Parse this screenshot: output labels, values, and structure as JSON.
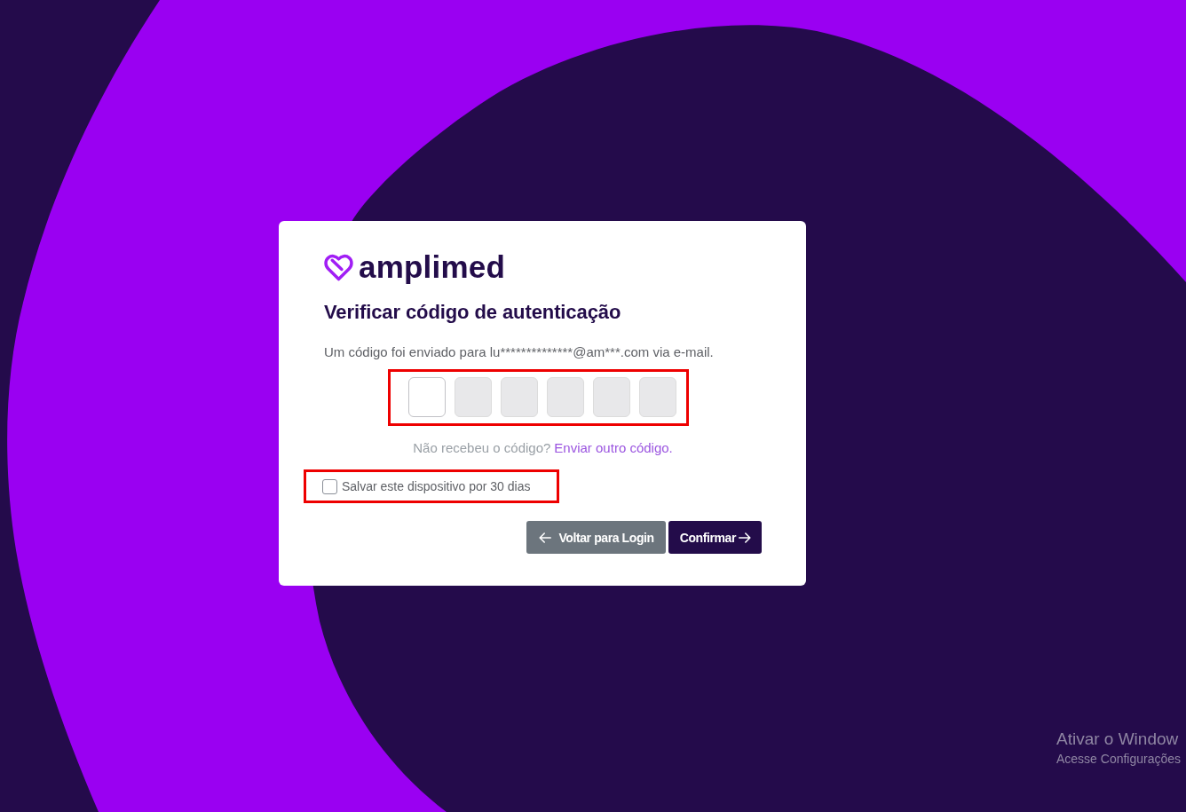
{
  "brand": {
    "name": "amplimed"
  },
  "title": "Verificar código de autenticação",
  "message": "Um código foi enviado para lu**************@am***.com via e-mail.",
  "code_group": {
    "highlighted": true,
    "fields": [
      {
        "focused": true
      },
      {
        "focused": false
      },
      {
        "focused": false
      },
      {
        "focused": false
      },
      {
        "focused": false
      },
      {
        "focused": false
      }
    ]
  },
  "resend": {
    "prompt": "Não recebeu o código?",
    "link": "Enviar outro código."
  },
  "remember_device": {
    "label": "Salvar este dispositivo por 30 dias",
    "checked": false,
    "highlighted": true
  },
  "buttons": [
    {
      "kind": "back",
      "label": "Voltar para Login"
    },
    {
      "kind": "confirm",
      "label": "Confirmar"
    }
  ],
  "os_overlay": {
    "title": "Ativar o Window",
    "subtitle": "Acesse Configurações"
  }
}
